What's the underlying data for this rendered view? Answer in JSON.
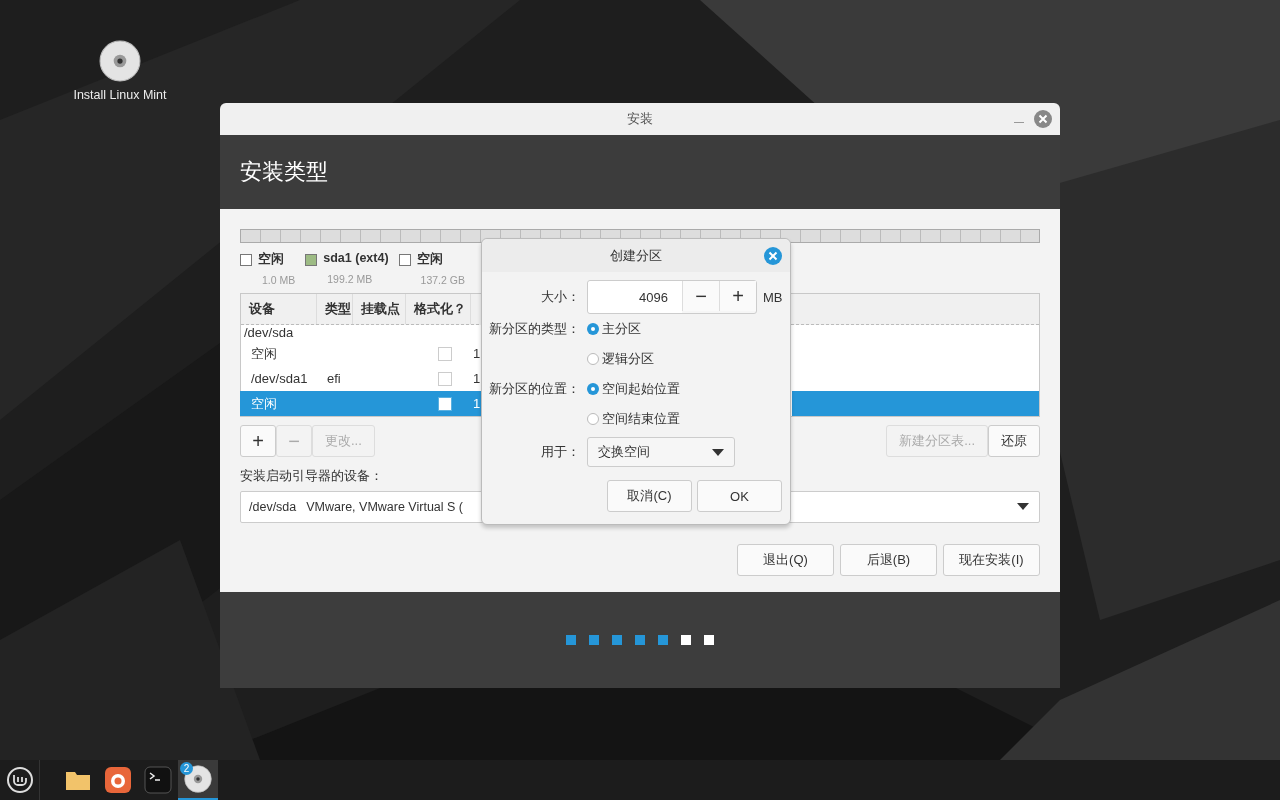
{
  "desktop": {
    "icons": [
      {
        "label": "Install Linux Mint"
      }
    ]
  },
  "window": {
    "title": "安装",
    "heading": "安装类型",
    "legend": [
      {
        "name": "空闲",
        "size": "1.0 MB",
        "color": "#ffffff"
      },
      {
        "name": "sda1 (ext4)",
        "size": "199.2 MB",
        "color": "#9dbb84"
      },
      {
        "name": "空闲",
        "size": "137.2 GB",
        "color": "#ffffff"
      }
    ],
    "table": {
      "columns": [
        "设备",
        "类型",
        "挂载点",
        "格式化？"
      ],
      "rows": [
        {
          "kind": "disk",
          "device": "/dev/sda",
          "selected": false
        },
        {
          "kind": "partition",
          "device": "空闲",
          "format": false,
          "column_5": "1",
          "selected": false
        },
        {
          "kind": "partition",
          "device": "/dev/sda1",
          "type": "efi",
          "format": false,
          "column_5": "1",
          "selected": false
        },
        {
          "kind": "partition",
          "device": "空闲",
          "format": false,
          "column_5": "1",
          "selected": true
        }
      ]
    },
    "table_buttons": [
      {
        "kind": "icon",
        "label": "+",
        "disabled": false
      },
      {
        "kind": "icon",
        "label": "−",
        "disabled": true
      },
      {
        "kind": "text",
        "label": "更改...",
        "disabled": true
      }
    ],
    "table_actions": [
      {
        "label": "新建分区表...",
        "disabled": true
      },
      {
        "label": "还原",
        "disabled": false
      }
    ],
    "bootloader": {
      "label": "安装启动引导器的设备：",
      "device": "/dev/sda",
      "model": "VMware, VMware Virtual S ("
    },
    "actions": [
      "退出(Q)",
      "后退(B)",
      "现在安装(I)"
    ],
    "steps": [
      {
        "done": true
      },
      {
        "done": true
      },
      {
        "done": true
      },
      {
        "done": true
      },
      {
        "done": true
      },
      {
        "done": false
      },
      {
        "done": false
      }
    ]
  },
  "dialog": {
    "title": "创建分区",
    "size": {
      "label": "大小：",
      "value": "4096",
      "decrement": "−",
      "increment": "+",
      "unit": "MB"
    },
    "groups": [
      {
        "label": "新分区的类型：",
        "options": [
          {
            "label": "主分区",
            "selected": true
          },
          {
            "label": "逻辑分区",
            "selected": false
          }
        ]
      },
      {
        "label": "新分区的位置：",
        "options": [
          {
            "label": "空间起始位置",
            "selected": true
          },
          {
            "label": "空间结束位置",
            "selected": false
          }
        ]
      }
    ],
    "use": {
      "label": "用于：",
      "value": "交换空间"
    },
    "buttons": [
      "取消(C)",
      "OK"
    ]
  },
  "taskbar": {
    "apps": [
      {
        "kind": "files",
        "active": false
      },
      {
        "kind": "browser",
        "active": false
      },
      {
        "kind": "terminal",
        "active": false
      },
      {
        "kind": "disc",
        "active": true,
        "badge": "2"
      }
    ]
  }
}
